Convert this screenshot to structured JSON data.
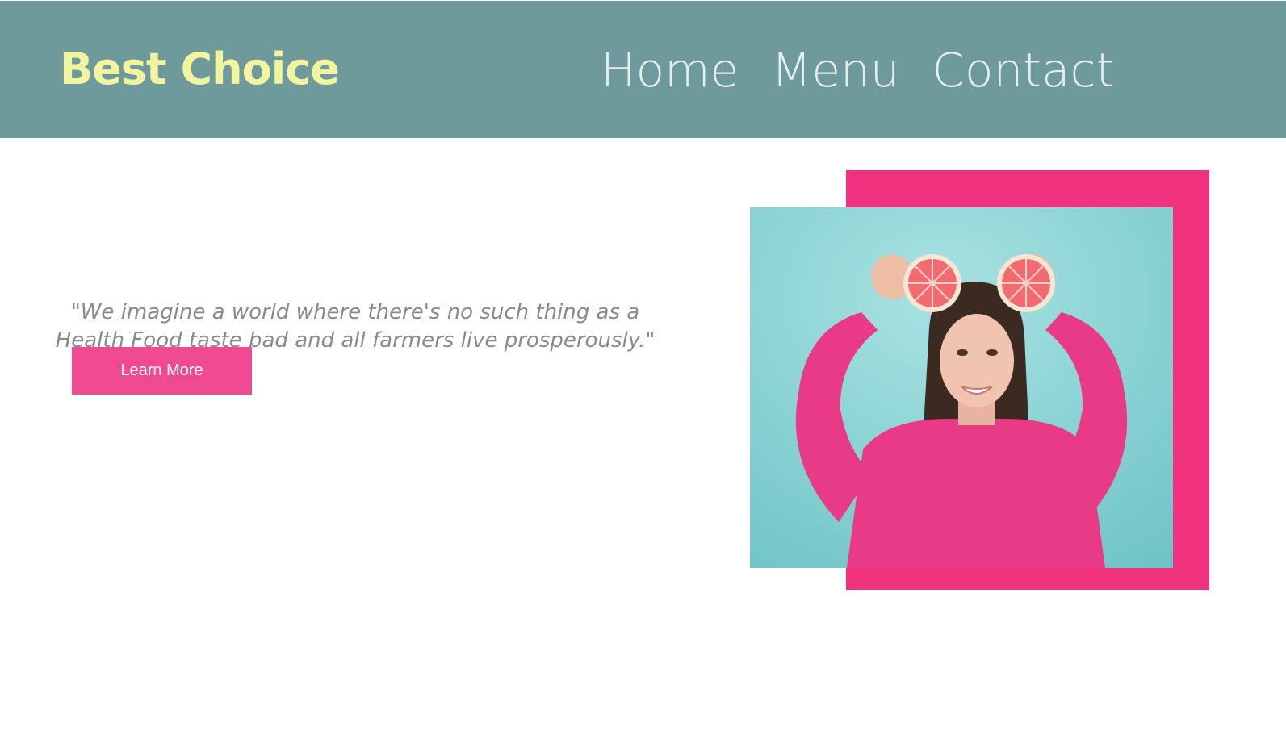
{
  "colors": {
    "header_bg": "#6e9a9c",
    "brand": "#f2f4a0",
    "nav_text": "#e6eeee",
    "quote_text": "#8a8a8a",
    "accent": "#f0327f",
    "button_bg": "#f04a92",
    "photo_bg": "#86d0d2",
    "sweater": "#e83a86"
  },
  "header": {
    "brand": "Best Choice",
    "nav": [
      {
        "label": "Home"
      },
      {
        "label": "Menu"
      },
      {
        "label": "Contact"
      }
    ]
  },
  "hero": {
    "quote": "\"We imagine a world where there's no such thing as a\nHealth Food taste bad and all farmers live prosperously.\"",
    "button_label": "Learn More",
    "image": {
      "icon": "woman-holding-grapefruit-photo"
    }
  }
}
